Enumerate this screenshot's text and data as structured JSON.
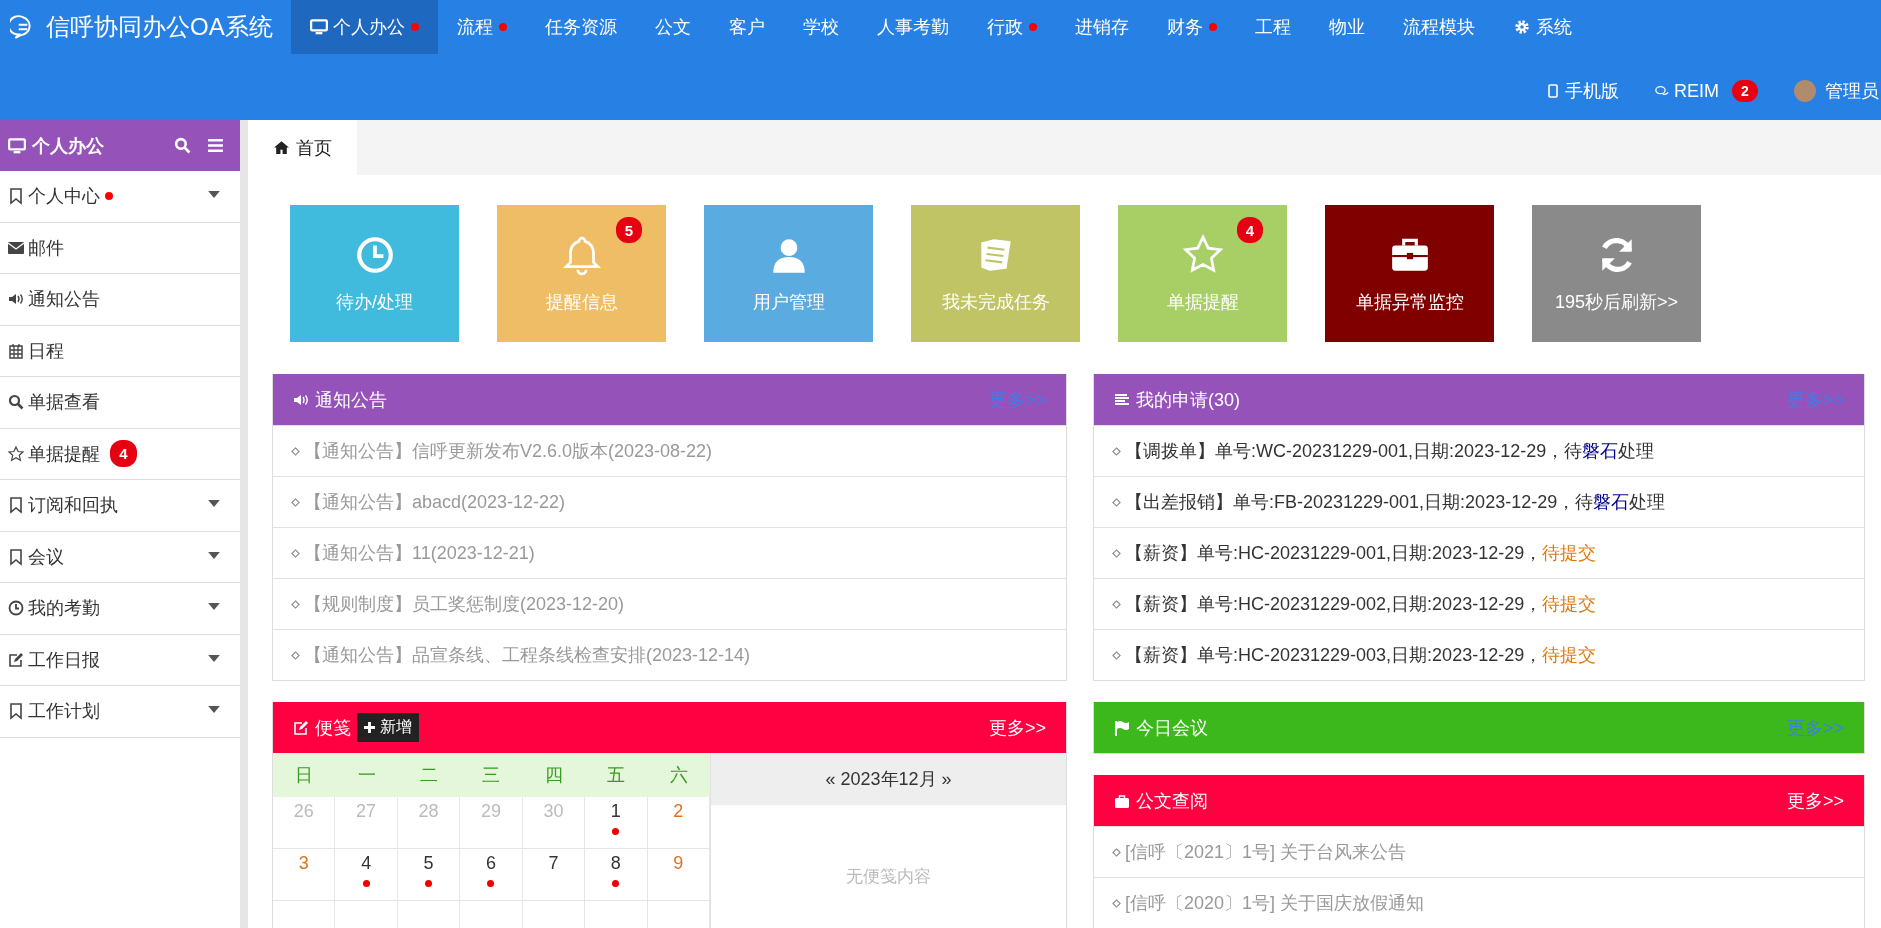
{
  "app": {
    "title": "信呼协同办公OA系统"
  },
  "nav": [
    {
      "label": "个人办公",
      "dot": true,
      "selected": true
    },
    {
      "label": "流程",
      "dot": true,
      "selected": false
    },
    {
      "label": "任务资源",
      "dot": false,
      "selected": false
    },
    {
      "label": "公文",
      "dot": false,
      "selected": false
    },
    {
      "label": "客户",
      "dot": false,
      "selected": false
    },
    {
      "label": "学校",
      "dot": false,
      "selected": false
    },
    {
      "label": "人事考勤",
      "dot": false,
      "selected": false
    },
    {
      "label": "行政",
      "dot": true,
      "selected": false
    },
    {
      "label": "进销存",
      "dot": false,
      "selected": false
    },
    {
      "label": "财务",
      "dot": true,
      "selected": false
    },
    {
      "label": "工程",
      "dot": false,
      "selected": false
    },
    {
      "label": "物业",
      "dot": false,
      "selected": false
    },
    {
      "label": "流程模块",
      "dot": false,
      "selected": false
    },
    {
      "label": "系统",
      "dot": false,
      "selected": false
    }
  ],
  "toolbar": {
    "mobile": "手机版",
    "chat": "REIM",
    "chat_badge": "2",
    "user": "管理员"
  },
  "sidebar": {
    "title": "个人办公",
    "items": [
      {
        "label": "个人中心",
        "dot": true,
        "expandable": true
      },
      {
        "label": "邮件",
        "dot": false,
        "expandable": false
      },
      {
        "label": "通知公告",
        "dot": false,
        "expandable": false
      },
      {
        "label": "日程",
        "dot": false,
        "expandable": false
      },
      {
        "label": "单据查看",
        "dot": false,
        "expandable": false
      },
      {
        "label": "单据提醒",
        "dot": false,
        "expandable": false,
        "badge": "4"
      },
      {
        "label": "订阅和回执",
        "dot": false,
        "expandable": true
      },
      {
        "label": "会议",
        "dot": false,
        "expandable": true
      },
      {
        "label": "我的考勤",
        "dot": false,
        "expandable": true
      },
      {
        "label": "工作日报",
        "dot": false,
        "expandable": true
      },
      {
        "label": "工作计划",
        "dot": false,
        "expandable": true
      }
    ]
  },
  "tabs": [
    {
      "label": "首页",
      "selected": true
    }
  ],
  "tiles": [
    {
      "label": "待办/处理",
      "color": "#41bbdd"
    },
    {
      "label": "提醒信息",
      "color": "#efbd66",
      "badge": "5"
    },
    {
      "label": "用户管理",
      "color": "#5aabdf"
    },
    {
      "label": "我未完成任务",
      "color": "#c1c465"
    },
    {
      "label": "单据提醒",
      "color": "#a8cf66",
      "badge": "4"
    },
    {
      "label": "单据异常监控",
      "color": "#800000"
    },
    {
      "label": "195秒后刷新>>",
      "color": "#8a8a8a"
    }
  ],
  "notices": {
    "title": "通知公告",
    "more": "更多>>",
    "items": [
      "【通知公告】信呼更新发布V2.6.0版本(2023-08-22)",
      "【通知公告】abacd(2023-12-22)",
      "【通知公告】11(2023-12-21)",
      "【规则制度】员工奖惩制度(2023-12-20)",
      "【通知公告】品宣条线、工程条线检查安排(2023-12-14)"
    ]
  },
  "applications": {
    "title": "我的申请(30)",
    "more": "更多>>",
    "items": [
      {
        "text": "【调拨单】单号:WC-20231229-001,日期:2023-12-29，待",
        "handler": "磐石",
        "after": "处理"
      },
      {
        "text": "【出差报销】单号:FB-20231229-001,日期:2023-12-29，待",
        "handler": "磐石",
        "after": "处理"
      },
      {
        "text": "【薪资】单号:HC-20231229-001,日期:2023-12-29，",
        "status": "待提交"
      },
      {
        "text": "【薪资】单号:HC-20231229-002,日期:2023-12-29，",
        "status": "待提交"
      },
      {
        "text": "【薪资】单号:HC-20231229-003,日期:2023-12-29，",
        "status": "待提交"
      }
    ]
  },
  "memo": {
    "title": "便笺",
    "add": "新增",
    "more": "更多>>",
    "month": "« 2023年12月 »",
    "empty": "无便笺内容",
    "weekdays": [
      "日",
      "一",
      "二",
      "三",
      "四",
      "五",
      "六"
    ],
    "days": [
      {
        "day": "26",
        "kind": "other",
        "dot": false
      },
      {
        "day": "27",
        "kind": "other",
        "dot": false
      },
      {
        "day": "28",
        "kind": "other",
        "dot": false
      },
      {
        "day": "29",
        "kind": "other",
        "dot": false
      },
      {
        "day": "30",
        "kind": "other",
        "dot": false
      },
      {
        "day": "1",
        "kind": "normal",
        "dot": true
      },
      {
        "day": "2",
        "kind": "weekend",
        "dot": false
      },
      {
        "day": "3",
        "kind": "weekend",
        "dot": false
      },
      {
        "day": "4",
        "kind": "normal",
        "dot": true
      },
      {
        "day": "5",
        "kind": "normal",
        "dot": true
      },
      {
        "day": "6",
        "kind": "normal",
        "dot": true
      },
      {
        "day": "7",
        "kind": "normal",
        "dot": false
      },
      {
        "day": "8",
        "kind": "normal",
        "dot": true
      },
      {
        "day": "9",
        "kind": "weekend",
        "dot": false
      }
    ]
  },
  "meetings": {
    "title": "今日会议",
    "more": "更多>>"
  },
  "documents": {
    "title": "公文查阅",
    "more": "更多>>",
    "items": [
      "[信呼〔2021〕1号] 关于台风来公告",
      "[信呼〔2020〕1号] 关于国庆放假通知"
    ]
  }
}
